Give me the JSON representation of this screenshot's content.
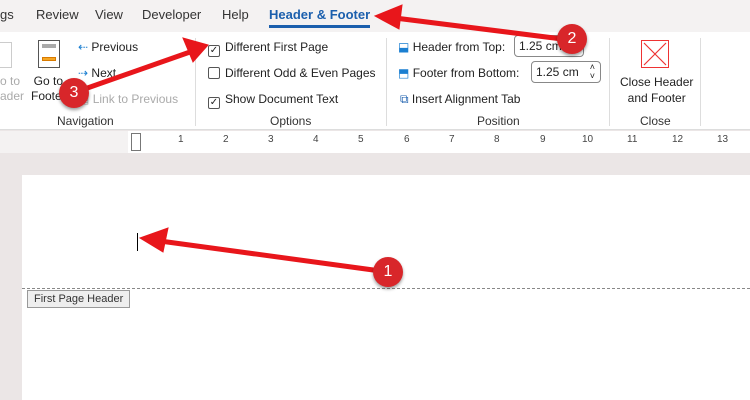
{
  "tabs": [
    "gs",
    "Review",
    "View",
    "Developer",
    "Help",
    "Header & Footer"
  ],
  "navigation": {
    "goto_header": "o to\nader",
    "goto_header_l1": "o to",
    "goto_header_l2": "ader",
    "goto_footer_l1": "Go to",
    "goto_footer_l2": "Footer",
    "previous": "Previous",
    "next": "Next",
    "link_prev": "Link to Previous",
    "label": "Navigation"
  },
  "options": {
    "diff_first": "Different First Page",
    "diff_first_checked": true,
    "diff_odd_even": "Different Odd & Even Pages",
    "diff_odd_even_checked": false,
    "show_doc": "Show Document Text",
    "show_doc_checked": true,
    "label": "Options"
  },
  "position": {
    "header_top": "Header from Top:",
    "header_top_value": "1.25 cm",
    "footer_bottom": "Footer from Bottom:",
    "footer_bottom_value": "1.25 cm",
    "align_tab": "Insert Alignment Tab",
    "label": "Position"
  },
  "close": {
    "l1": "Close Header",
    "l2": "and Footer",
    "label": "Close"
  },
  "ruler": [
    "1",
    "2",
    "3",
    "4",
    "5",
    "6",
    "7",
    "8",
    "9",
    "10",
    "11",
    "12",
    "13"
  ],
  "doc": {
    "header_label": "First Page Header"
  },
  "callouts": [
    "1",
    "2",
    "3"
  ],
  "colors": {
    "accent": "#1b5fad",
    "arrow": "#e8161b"
  }
}
